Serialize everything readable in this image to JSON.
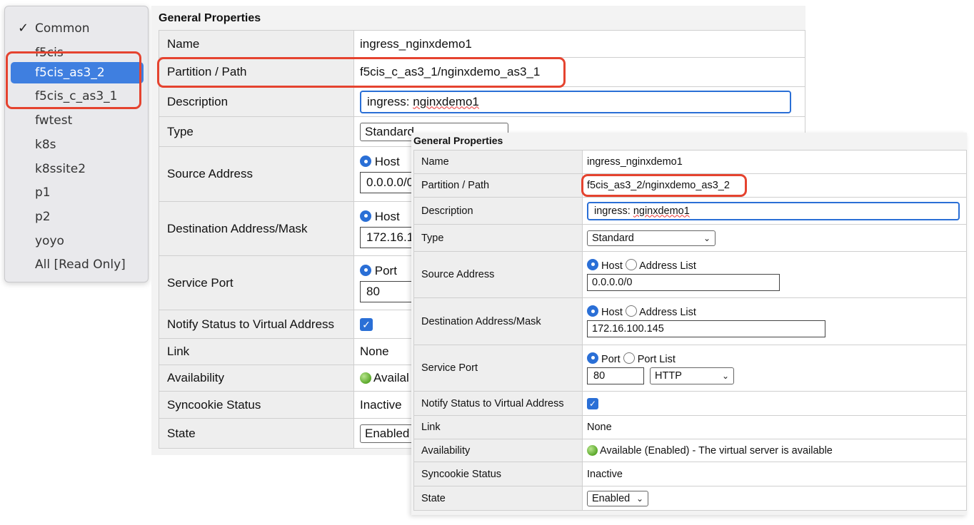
{
  "partition_menu": {
    "items": [
      {
        "label": "Common",
        "checked": true
      },
      {
        "label": "f5cis"
      },
      {
        "label": "f5cis_as3_2",
        "selected": true
      },
      {
        "label": "f5cis_c_as3_1"
      },
      {
        "label": "fwtest"
      },
      {
        "label": "k8s"
      },
      {
        "label": "k8ssite2"
      },
      {
        "label": "p1"
      },
      {
        "label": "p2"
      },
      {
        "label": "yoyo"
      },
      {
        "label": "All [Read Only]"
      }
    ],
    "check_glyph": "✓"
  },
  "panel_back": {
    "title": "General Properties",
    "labels": {
      "name": "Name",
      "partition": "Partition / Path",
      "description": "Description",
      "type": "Type",
      "source": "Source Address",
      "dest": "Destination Address/Mask",
      "port": "Service Port",
      "notify": "Notify Status to Virtual Address",
      "link": "Link",
      "availability": "Availability",
      "syncookie": "Syncookie Status",
      "state": "State"
    },
    "values": {
      "name": "ingress_nginxdemo1",
      "partition": "f5cis_c_as3_1/nginxdemo_as3_1",
      "description_prefix": "ingress: ",
      "description_word": "nginxdemo1",
      "type": "Standard",
      "host": "Host",
      "source": "0.0.0.0/0",
      "dest": "172.16.1",
      "port_radio": "Port",
      "port": "80",
      "link": "None",
      "availability": "Availal",
      "syncookie": "Inactive",
      "state": "Enabled"
    }
  },
  "panel_front": {
    "title": "General Properties",
    "labels": {
      "name": "Name",
      "partition": "Partition / Path",
      "description": "Description",
      "type": "Type",
      "source": "Source Address",
      "dest": "Destination Address/Mask",
      "port": "Service Port",
      "notify": "Notify Status to Virtual Address",
      "link": "Link",
      "availability": "Availability",
      "syncookie": "Syncookie Status",
      "state": "State"
    },
    "values": {
      "name": "ingress_nginxdemo1",
      "partition": "f5cis_as3_2/nginxdemo_as3_2",
      "description_prefix": "ingress: ",
      "description_word": "nginxdemo1",
      "type": "Standard",
      "host": "Host",
      "address_list": "Address List",
      "source": "0.0.0.0/0",
      "dest": "172.16.100.145",
      "port_radio": "Port",
      "port_list": "Port List",
      "port": "80",
      "protocol": "HTTP",
      "notify_checked": true,
      "link": "None",
      "availability": "Available (Enabled) - The virtual server is available",
      "syncookie": "Inactive",
      "state": "Enabled"
    }
  },
  "colors": {
    "highlight_red": "#e5432f",
    "selection_blue": "#3f7fe0",
    "focus_blue": "#2a6fd6"
  },
  "icons": {
    "chevron": "chevron-down-icon",
    "status": "green-status-dot-icon"
  }
}
